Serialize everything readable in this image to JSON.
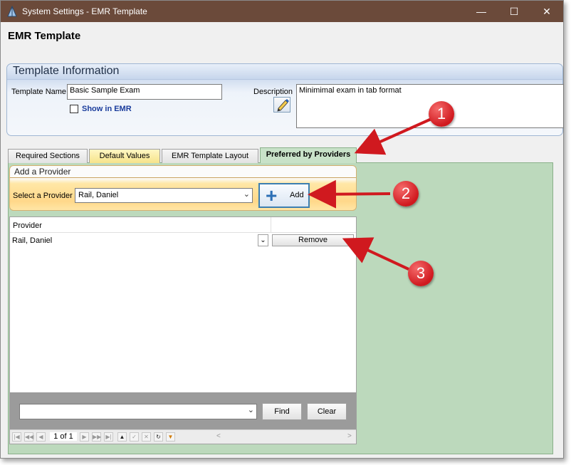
{
  "window": {
    "title": "System Settings - EMR Template",
    "controls": [
      "minimize",
      "maximize",
      "close"
    ]
  },
  "page": {
    "heading": "EMR Template"
  },
  "template_info": {
    "section_title": "Template Information",
    "name_label": "Template Name",
    "name_value": "Basic Sample Exam",
    "show_in_emr_label": "Show in EMR",
    "show_in_emr_checked": false,
    "description_label": "Description",
    "description_value": "Minimimal exam in tab format"
  },
  "tabs": [
    {
      "label": "Required Sections",
      "active": false
    },
    {
      "label": "Default Values",
      "active": false
    },
    {
      "label": "EMR Template Layout",
      "active": false
    },
    {
      "label": "Preferred by Providers",
      "active": true
    }
  ],
  "add_provider": {
    "title": "Add a Provider",
    "select_label": "Select a Provider",
    "selected_provider": "Rail, Daniel",
    "add_label": "Add"
  },
  "providers_grid": {
    "column_header": "Provider",
    "rows": [
      {
        "provider": "Rail, Daniel",
        "action": "Remove"
      }
    ],
    "find_label": "Find",
    "clear_label": "Clear",
    "page_indicator": "1 of 1"
  },
  "callouts": [
    "1",
    "2",
    "3"
  ],
  "colors": {
    "titlebar": "#6b4a3a",
    "content_bg": "#bcd9bc",
    "callout": "#d0191f",
    "accent": "#2d6fb5"
  }
}
